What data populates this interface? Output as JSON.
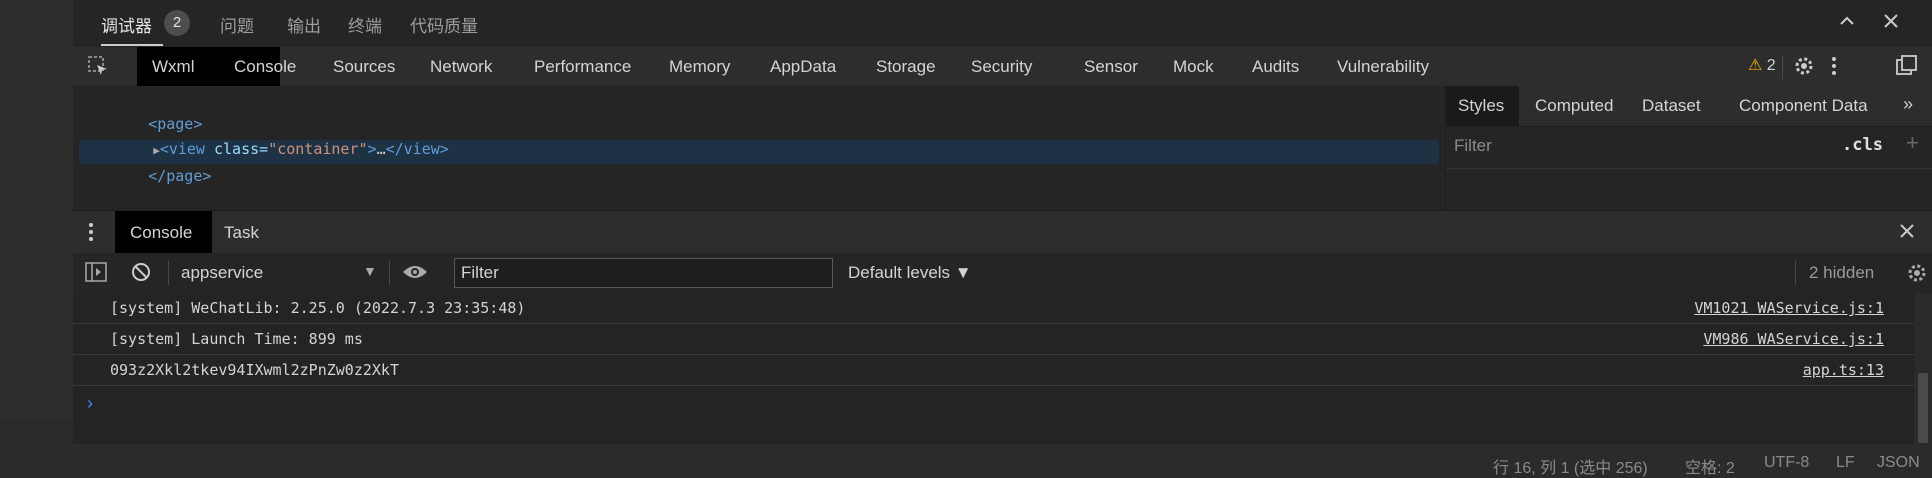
{
  "panel": {
    "tabs": [
      {
        "label": "调试器"
      },
      {
        "label": "问题"
      },
      {
        "label": "输出"
      },
      {
        "label": "终端"
      },
      {
        "label": "代码质量"
      }
    ],
    "badge": "2"
  },
  "devtools": {
    "tabs": [
      "Wxml",
      "Console",
      "Sources",
      "Network",
      "Performance",
      "Memory",
      "AppData",
      "Storage",
      "Security",
      "Sensor",
      "Mock",
      "Audits",
      "Vulnerability"
    ],
    "warning_icon": "⚠",
    "warning_count": "2"
  },
  "wxml": {
    "line1": "<page>",
    "line2_open": "<view",
    "line2_attr": " class=",
    "line2_val": "\"container\"",
    "line2_close": ">",
    "line2_dots": "…",
    "line2_end": "</view>",
    "line3": "</page>"
  },
  "styles": {
    "tabs": [
      "Styles",
      "Computed",
      "Dataset",
      "Component Data"
    ],
    "filter_placeholder": "Filter",
    "cls": ".cls",
    "plus": "+"
  },
  "drawer": {
    "tabs": [
      "Console",
      "Task"
    ]
  },
  "console": {
    "context": "appservice",
    "filter_placeholder": "Filter",
    "levels": "Default levels ▼",
    "hidden": "2 hidden",
    "rows": [
      {
        "msg": "[system] WeChatLib: 2.25.0 (2022.7.3 23:35:48)",
        "src": "VM1021 WAService.js:1"
      },
      {
        "msg": "[system] Launch Time: 899 ms",
        "src": "VM986 WAService.js:1"
      },
      {
        "msg": "093z2Xkl2tkev94IXwml2zPnZw0z2XkT",
        "src": "app.ts:13"
      }
    ],
    "prompt": "›"
  },
  "statusbar": {
    "position": "行 16, 列 1 (选中 256)",
    "spaces": "空格: 2",
    "encoding": "UTF-8",
    "eol": "LF",
    "language": "JSON"
  },
  "colors": {
    "accent": "#3794ff",
    "warning": "#f5b400",
    "tag": "#5f9dd6",
    "attr_value": "#ce9178"
  }
}
